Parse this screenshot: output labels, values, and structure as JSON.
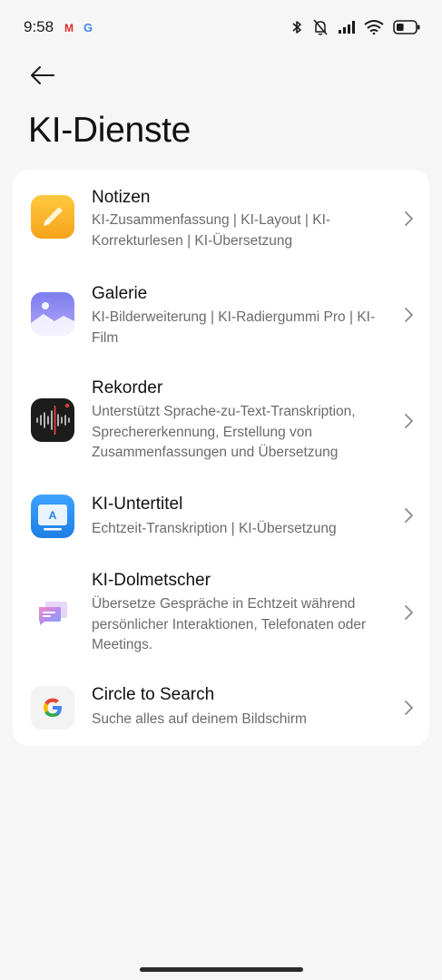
{
  "status_bar": {
    "time": "9:58",
    "left_icons": [
      "gmail-icon",
      "google-icon"
    ],
    "right_icons": [
      "bluetooth-icon",
      "mute-icon",
      "signal-icon",
      "wifi-icon",
      "battery-icon"
    ],
    "battery_level": 0.4
  },
  "header": {
    "back_icon": "arrow-left-icon",
    "title": "KI-Dienste"
  },
  "services": [
    {
      "icon": "notes-app-icon",
      "title": "Notizen",
      "description": "KI-Zusammenfassung | KI-Layout | KI-Korrekturlesen | KI-Übersetzung"
    },
    {
      "icon": "gallery-app-icon",
      "title": "Galerie",
      "description": "KI-Bilderweiterung | KI-Radiergummi Pro | KI-Film"
    },
    {
      "icon": "recorder-app-icon",
      "title": "Rekorder",
      "description": "Unterstützt Sprache-zu-Text-Transkription, Sprechererkennung, Erstellung von Zusammenfassungen und Übersetzung"
    },
    {
      "icon": "subtitles-app-icon",
      "title": "KI-Untertitel",
      "description": "Echtzeit-Transkription | KI-Übersetzung"
    },
    {
      "icon": "interpreter-app-icon",
      "title": "KI-Dolmetscher",
      "description": "Übersetze Gespräche in Echtzeit während persönlicher Interaktionen, Telefonaten oder Meetings."
    },
    {
      "icon": "google-app-icon",
      "title": "Circle to Search",
      "description": "Suche alles auf deinem Bildschirm"
    }
  ],
  "icon_text": {
    "gmail_glyph": "M",
    "google_glyph": "G",
    "subtitles_glyph": "A"
  },
  "colors": {
    "background": "#f6f6f6",
    "card": "#ffffff",
    "notes": "#fbb52b",
    "gallery": "#8f8ff0",
    "recorder": "#1a1a1a",
    "recorder_accent": "#e8423a",
    "subtitles": "#2a8ff0"
  }
}
